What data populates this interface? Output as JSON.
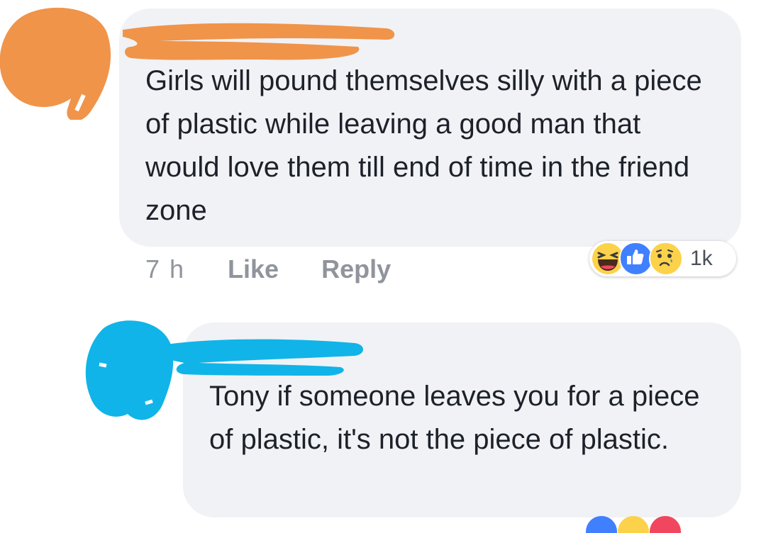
{
  "comments": [
    {
      "text": "Girls will pound themselves silly with a piece of plastic while leaving a good man that would love them till end of time in the friend zone",
      "time": "7 h",
      "like_label": "Like",
      "reply_label": "Reply",
      "reactions": {
        "icons": [
          "haha-icon",
          "like-icon",
          "sad-icon"
        ],
        "count": "1k"
      },
      "redaction_color": "#f0944a"
    },
    {
      "text": "Tony if someone leaves you for a piece of plastic, it's not the piece of plastic.",
      "reactions": {
        "icons": [
          "like-icon",
          "haha-icon",
          "love-icon"
        ]
      },
      "redaction_color": "#10b4e8"
    }
  ],
  "colors": {
    "bubble": "#f1f2f6",
    "text": "#1d2129",
    "meta": "#90949c",
    "like_blue": "#4080ff",
    "haha_yellow": "#fcd24a",
    "love_red": "#f0475e"
  }
}
